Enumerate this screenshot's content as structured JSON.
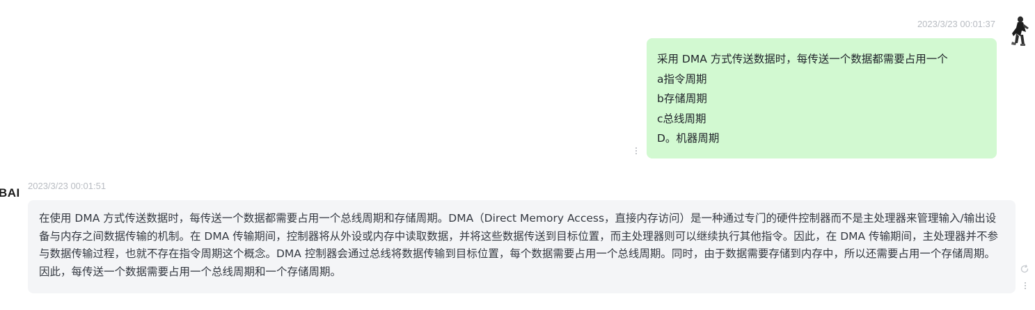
{
  "conversation": {
    "user_message": {
      "timestamp": "2023/3/23 00:01:37",
      "lines": [
        "采用 DMA 方式传送数据时，每传送一个数据都需要占用一个",
        "a指令周期",
        "b存储周期",
        "c总线周期",
        "D。机器周期"
      ]
    },
    "ai_message": {
      "sender_label": "BAI",
      "timestamp": "2023/3/23 00:01:51",
      "text": "在使用 DMA 方式传送数据时，每传送一个数据都需要占用一个总线周期和存储周期。DMA（Direct Memory Access，直接内存访问）是一种通过专门的硬件控制器而不是主处理器来管理输入/输出设备与内存之间数据传输的机制。在 DMA 传输期间，控制器将从外设或内存中读取数据，并将这些数据传送到目标位置，而主处理器则可以继续执行其他指令。因此，在 DMA 传输期间，主处理器并不参与数据传输过程，也就不存在指令周期这个概念。DMA 控制器会通过总线将数据传输到目标位置，每个数据需要占用一个总线周期。同时，由于数据需要存储到内存中，所以还需要占用一个存储周期。因此，每传送一个数据需要占用一个总线周期和一个存储周期。"
    }
  },
  "icons": {
    "user_avatar": "user-avatar-icon",
    "more_menu": "more-vertical-icon",
    "regenerate": "refresh-icon"
  },
  "colors": {
    "user_bubble": "#d2f9d1",
    "ai_bubble": "#f4f5f7",
    "timestamp": "#b8bcc2"
  }
}
